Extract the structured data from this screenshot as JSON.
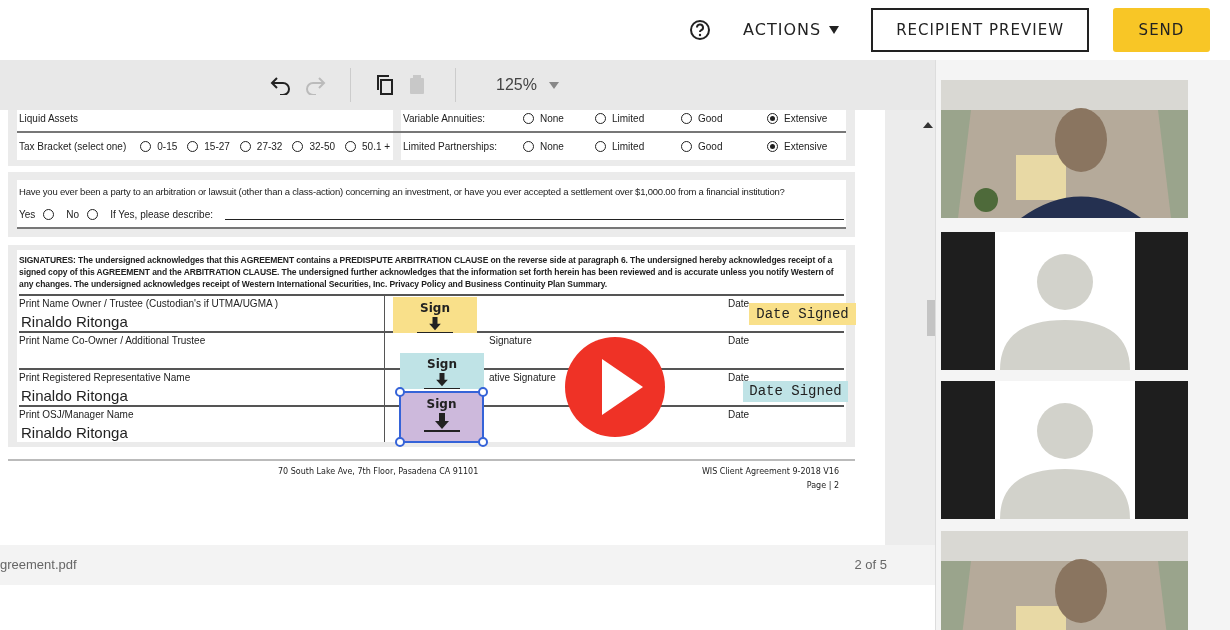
{
  "header": {
    "actions": "ACTIONS",
    "preview": "RECIPIENT PREVIEW",
    "send": "SEND"
  },
  "toolbar": {
    "zoom": "125%"
  },
  "document": {
    "rows": [
      {
        "label": "Liquid Assets",
        "options": [],
        "right_label": "Variable Annuities:",
        "right_options": [
          {
            "label": "None",
            "selected": false
          },
          {
            "label": "Limited",
            "selected": false
          },
          {
            "label": "Good",
            "selected": false
          },
          {
            "label": "Extensive",
            "selected": true
          }
        ]
      },
      {
        "label": "Tax Bracket (select one)",
        "options": [
          {
            "label": "0-15",
            "selected": false
          },
          {
            "label": "15-27",
            "selected": false
          },
          {
            "label": "27-32",
            "selected": false
          },
          {
            "label": "32-50",
            "selected": false
          },
          {
            "label": "50.1 +",
            "selected": false
          }
        ],
        "right_label": "Limited Partnerships:",
        "right_options": [
          {
            "label": "None",
            "selected": false
          },
          {
            "label": "Limited",
            "selected": false
          },
          {
            "label": "Good",
            "selected": false
          },
          {
            "label": "Extensive",
            "selected": true
          }
        ]
      }
    ],
    "question": {
      "text": "Have you ever been a party to an arbitration or lawsuit (other than a class-action) concerning an investment, or have you ever accepted a settlement over $1,000.00 from a financial institution?",
      "options": [
        {
          "label": "Yes",
          "selected": false
        },
        {
          "label": "No",
          "selected": false
        }
      ],
      "describe": "If Yes, please describe:"
    },
    "signatures": {
      "text": "SIGNATURES: The undersigned acknowledges that this AGREEMENT contains a PREDISPUTE ARBITRATION CLAUSE on the reverse side at paragraph 6. The undersigned hereby acknowledges receipt of a signed copy of this AGREEMENT and the ARBITRATION CLAUSE. The undersigned further acknowledges that the information set forth herein has been reviewed and is accurate unless you notify Western of any changes. The undersigned acknowledges receipt of Western International Securities, Inc. Privacy Policy and Business Continuity Plan Summary.",
      "rows": [
        {
          "name_label": "Print Name Owner / Trustee (Custodian's if UTMA/UGMA )",
          "name_value": "Rinaldo Ritonga",
          "date_label": "Date"
        },
        {
          "name_label": "Print Name Co-Owner / Additional Trustee",
          "signature_label": "Signature",
          "date_label": "Date"
        },
        {
          "name_label": "Print Registered Representative Name",
          "name_value": "Rinaldo Ritonga",
          "signature_label": "ative Signature",
          "date_label": "Date"
        },
        {
          "name_label": "Print OSJ/Manager Name",
          "name_value": "Rinaldo Ritonga",
          "date_label": "Date"
        }
      ]
    },
    "footer": {
      "address": "70 South Lake Ave, 7th Floor, Pasadena CA 91101",
      "form_id": "WIS Client Agreement 9-2018 V16",
      "page": "Page | 2"
    }
  },
  "fields": [
    {
      "kind": "signature",
      "label": "Sign",
      "color": "#f9e08a",
      "selected": false
    },
    {
      "kind": "date",
      "label": "Date Signed",
      "color": "#f9e08a",
      "selected": false
    },
    {
      "kind": "signature",
      "label": "Sign",
      "color": "#bfe3e6",
      "selected": false
    },
    {
      "kind": "date",
      "label": "Date Signed",
      "color": "#bfe3e6",
      "selected": false
    },
    {
      "kind": "signature",
      "label": "Sign",
      "color": "#cdb9dc",
      "selected": true
    }
  ],
  "file_bar": {
    "filename": "greement.pdf",
    "page_count": "2 of 5"
  },
  "video_tiles": [
    {
      "kind": "picture"
    },
    {
      "kind": "avatar"
    },
    {
      "kind": "avatar"
    },
    {
      "kind": "picture"
    }
  ]
}
